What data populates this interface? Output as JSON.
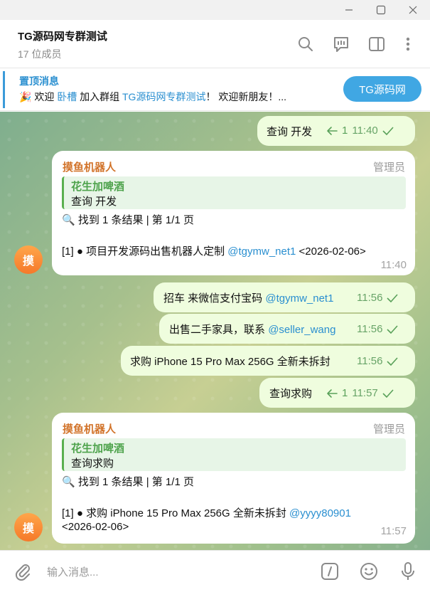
{
  "window": {
    "controls": [
      "minimize",
      "maximize",
      "close"
    ]
  },
  "header": {
    "title": "TG源码网专群测试",
    "subtitle": "17 位成员",
    "icons": [
      "search-icon",
      "topic-icon",
      "sidebar-icon",
      "more-icon"
    ]
  },
  "pinned": {
    "title": "置顶消息",
    "emoji": "🎉",
    "text_welcome": "欢迎",
    "user": "卧槽",
    "text_join": "加入群组",
    "group": "TG源码网专群测试",
    "text_tail": "！ 欢迎新朋友！...",
    "button": "TG源码网"
  },
  "messages": {
    "m1": {
      "text": "查询 开发",
      "reply_count": "1",
      "time": "11:40"
    },
    "m2": {
      "sender": "摸鱼机器人",
      "role": "管理员",
      "quote_name": "花生加啤酒",
      "quote_text": "查询 开发",
      "search_icon": "🔍",
      "result": "找到 1 条结果 | 第 1/1 页",
      "line_prefix": "[1] ● 项目开发源码出售机器人定制",
      "line_link": "@tgymw_net1",
      "line_date": "<2026-02-06>",
      "time": "11:40",
      "avatar": "摸"
    },
    "m3": {
      "text": "招车 来微信支付宝码",
      "link": "@tgymw_net1",
      "time": "11:56"
    },
    "m4": {
      "text": "出售二手家具，联系",
      "link": "@seller_wang",
      "time": "11:56"
    },
    "m5": {
      "text": "求购 iPhone 15 Pro Max 256G 全新未拆封",
      "time": "11:56"
    },
    "m6": {
      "text": "查询求购",
      "reply_count": "1",
      "time": "11:57"
    },
    "m7": {
      "sender": "摸鱼机器人",
      "role": "管理员",
      "quote_name": "花生加啤酒",
      "quote_text": "查询求购",
      "search_icon": "🔍",
      "result": "找到 1 条结果 | 第 1/1 页",
      "line_prefix": "[1] ● 求购 iPhone 15 Pro Max 256G 全新未拆封",
      "line_link": "@yyyy80901",
      "line_date": "<2026-02-06>",
      "time": "11:57",
      "avatar": "摸"
    }
  },
  "composer": {
    "placeholder": "输入消息..."
  },
  "colors": {
    "accent": "#40a7e3",
    "outgoing": "#effdde",
    "sender": "#d2742b",
    "quote": "#4ea34c"
  }
}
